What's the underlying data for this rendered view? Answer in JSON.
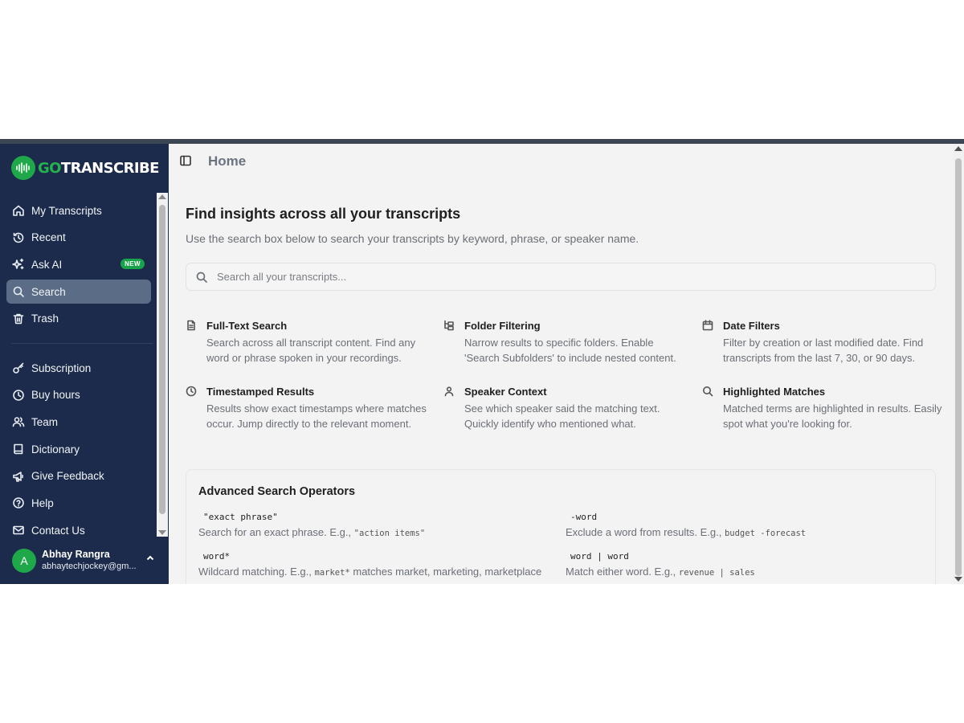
{
  "brand": {
    "go": "GO",
    "rest": "TRANSCRIBE"
  },
  "sidebar": {
    "items": [
      {
        "label": "My Transcripts",
        "icon": "home-icon"
      },
      {
        "label": "Recent",
        "icon": "history-icon"
      },
      {
        "label": "Ask AI",
        "icon": "sparkles-icon",
        "badge": "NEW"
      },
      {
        "label": "Search",
        "icon": "search-icon",
        "active": true
      },
      {
        "label": "Trash",
        "icon": "trash-icon"
      }
    ],
    "items2": [
      {
        "label": "Subscription",
        "icon": "key-icon"
      },
      {
        "label": "Buy hours",
        "icon": "clock-icon"
      },
      {
        "label": "Team",
        "icon": "users-icon"
      },
      {
        "label": "Dictionary",
        "icon": "book-icon"
      },
      {
        "label": "Give Feedback",
        "icon": "megaphone-icon"
      },
      {
        "label": "Help",
        "icon": "help-circle-icon"
      },
      {
        "label": "Contact Us",
        "icon": "mail-icon"
      }
    ],
    "user": {
      "initial": "A",
      "name": "Abhay Rangra",
      "email": "abhaytechjockey@gm..."
    }
  },
  "header": {
    "title": "Home"
  },
  "main": {
    "heading": "Find insights across all your transcripts",
    "subheading": "Use the search box below to search your transcripts by keyword, phrase, or speaker name.",
    "search_placeholder": "Search all your transcripts...",
    "features": [
      {
        "title": "Full-Text Search",
        "desc": "Search across all transcript content. Find any word or phrase spoken in your recordings.",
        "icon": "file-text-icon"
      },
      {
        "title": "Folder Filtering",
        "desc": "Narrow results to specific folders. Enable 'Search Subfolders' to include nested content.",
        "icon": "folder-tree-icon"
      },
      {
        "title": "Date Filters",
        "desc": "Filter by creation or last modified date. Find transcripts from the last 7, 30, or 90 days.",
        "icon": "calendar-icon"
      },
      {
        "title": "Timestamped Results",
        "desc": "Results show exact timestamps where matches occur. Jump directly to the relevant moment.",
        "icon": "clock-icon"
      },
      {
        "title": "Speaker Context",
        "desc": "See which speaker said the matching text. Quickly identify who mentioned what.",
        "icon": "user-icon"
      },
      {
        "title": "Highlighted Matches",
        "desc": "Matched terms are highlighted in results. Easily spot what you're looking for.",
        "icon": "search-icon"
      }
    ],
    "advanced": {
      "title": "Advanced Search Operators",
      "operators": [
        {
          "code": "\"exact phrase\"",
          "desc": "Search for an exact phrase. E.g., ",
          "example": "\"action items\"",
          "after": ""
        },
        {
          "code": "-word",
          "desc": "Exclude a word from results. E.g., ",
          "example": "budget -forecast",
          "after": ""
        },
        {
          "code": "word*",
          "desc": "Wildcard matching. E.g., ",
          "example": "market*",
          "after": " matches market, marketing, marketplace"
        },
        {
          "code": "word | word",
          "desc": "Match either word. E.g., ",
          "example": "revenue | sales",
          "after": ""
        }
      ]
    }
  }
}
